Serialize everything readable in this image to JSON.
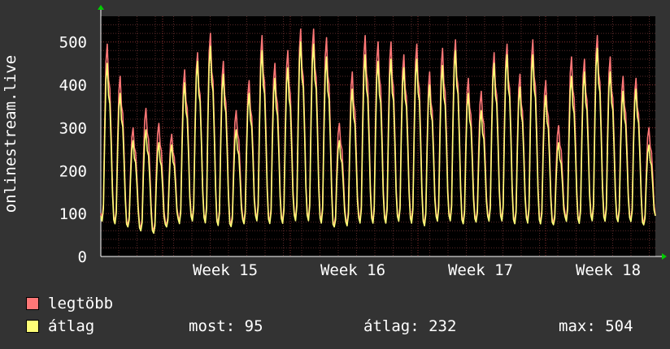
{
  "colors": {
    "background": "#333333",
    "plot_background": "#000000",
    "grid_minor": "#5a2a2a",
    "grid_major": "#8a3030",
    "axis": "#ffffff",
    "series_max": "#ff7777",
    "series_avg": "#ffff77",
    "arrow": "#00cc00"
  },
  "legend": {
    "max_label": "legtöbb",
    "avg_label": "átlag",
    "now_label": "most: 95",
    "avg_stat_label": "átlag: 232",
    "max_stat_label": "max: 504"
  },
  "chart_data": {
    "type": "line",
    "ylabel": "onlinestream.live",
    "xlabel": "",
    "title": "",
    "ylim": [
      0,
      560
    ],
    "yticks": [
      0,
      100,
      200,
      300,
      400,
      500
    ],
    "xticks": [
      "Week 15",
      "Week 16",
      "Week 17",
      "Week 18"
    ],
    "x": [
      "1",
      "2",
      "3",
      "4",
      "5",
      "6",
      "7",
      "8",
      "9",
      "10",
      "11",
      "12",
      "13",
      "14",
      "15",
      "16",
      "17",
      "18",
      "19",
      "20",
      "21",
      "22",
      "23",
      "24",
      "25",
      "26",
      "27",
      "28",
      "29",
      "30",
      "31",
      "32",
      "33",
      "34",
      "35",
      "36",
      "37",
      "38",
      "39",
      "40",
      "41",
      "42",
      "43"
    ],
    "grid": true,
    "series": [
      {
        "name": "legtöbb",
        "color": "#ff7777",
        "lows": [
          80,
          75,
          70,
          60,
          55,
          70,
          75,
          80,
          75,
          70,
          70,
          75,
          80,
          75,
          75,
          80,
          80,
          75,
          70,
          70,
          75,
          75,
          75,
          80,
          75,
          70,
          80,
          80,
          75,
          80,
          80,
          80,
          75,
          75,
          75,
          75,
          80,
          75,
          80,
          80,
          80,
          80,
          75
        ],
        "peaks": [
          495,
          420,
          300,
          345,
          310,
          285,
          435,
          475,
          520,
          455,
          340,
          410,
          515,
          450,
          480,
          530,
          530,
          510,
          310,
          430,
          515,
          500,
          500,
          470,
          495,
          430,
          485,
          505,
          415,
          385,
          475,
          495,
          425,
          505,
          410,
          305,
          465,
          460,
          515,
          465,
          420,
          415,
          300
        ]
      },
      {
        "name": "átlag",
        "color": "#ffff77",
        "lows": [
          75,
          70,
          65,
          55,
          50,
          65,
          70,
          75,
          70,
          65,
          65,
          70,
          75,
          70,
          70,
          75,
          75,
          70,
          65,
          65,
          70,
          70,
          70,
          75,
          70,
          65,
          75,
          75,
          70,
          75,
          75,
          75,
          70,
          70,
          70,
          70,
          75,
          70,
          75,
          75,
          75,
          75,
          70
        ],
        "peaks": [
          450,
          380,
          270,
          295,
          265,
          260,
          405,
          455,
          490,
          425,
          295,
          380,
          480,
          415,
          440,
          500,
          495,
          465,
          270,
          390,
          470,
          455,
          460,
          440,
          460,
          400,
          445,
          480,
          380,
          340,
          450,
          470,
          395,
          470,
          375,
          265,
          420,
          430,
          485,
          430,
          385,
          390,
          260
        ]
      }
    ]
  }
}
